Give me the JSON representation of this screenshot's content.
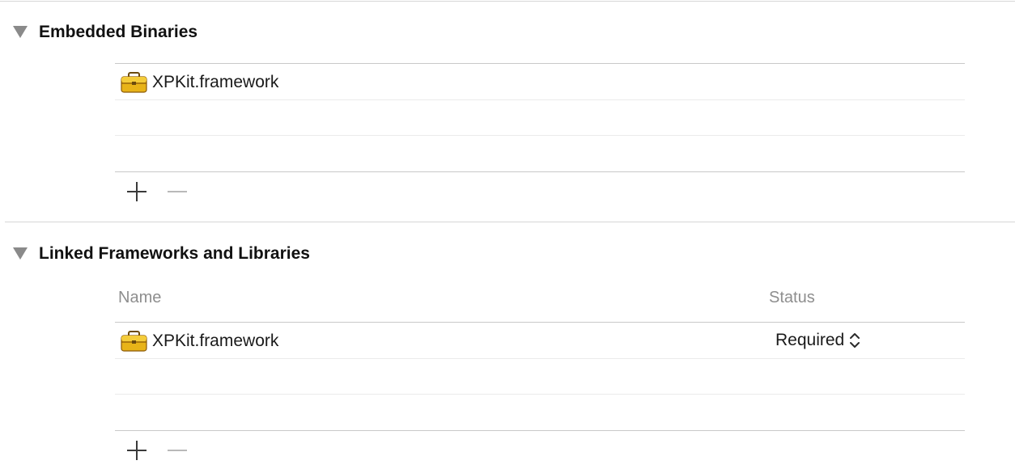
{
  "embedded_binaries": {
    "title": "Embedded Binaries",
    "items": [
      {
        "name": "XPKit.framework",
        "icon": "toolbox-icon"
      }
    ],
    "add_icon": "plus-icon",
    "remove_icon": "minus-icon"
  },
  "linked_frameworks": {
    "title": "Linked Frameworks and Libraries",
    "columns": {
      "name": "Name",
      "status": "Status"
    },
    "items": [
      {
        "name": "XPKit.framework",
        "status": "Required",
        "icon": "toolbox-icon"
      }
    ],
    "add_icon": "plus-icon",
    "remove_icon": "minus-icon"
  },
  "colors": {
    "separator": "#d6d6d6",
    "disclosure": "#8a8a8a",
    "header_text": "#8e8e8e",
    "toolbox_body": "#e8b318",
    "toolbox_dark": "#8a5a0a"
  }
}
